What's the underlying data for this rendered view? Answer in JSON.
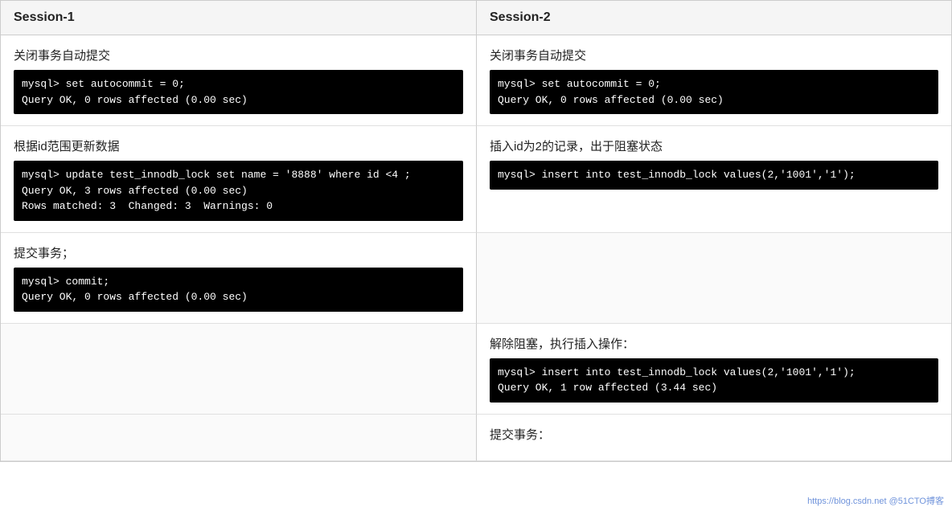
{
  "sessions": {
    "session1_header": "Session-1",
    "session2_header": "Session-2"
  },
  "rows": [
    {
      "left": {
        "label": "关闭事务自动提交",
        "code": "mysql> set autocommit = 0;\nQuery OK, 0 rows affected (0.00 sec)"
      },
      "right": {
        "label": "关闭事务自动提交",
        "code": "mysql> set autocommit = 0;\nQuery OK, 0 rows affected (0.00 sec)"
      }
    },
    {
      "left": {
        "label": "根据id范围更新数据",
        "code": "mysql> update test_innodb_lock set name = '8888' where id <4 ;\nQuery OK, 3 rows affected (0.00 sec)\nRows matched: 3  Changed: 3  Warnings: 0"
      },
      "right": {
        "label": "插入id为2的记录，出于阻塞状态",
        "code": "mysql> insert into test_innodb_lock values(2,'1001','1');"
      }
    },
    {
      "left": {
        "label": "提交事务；",
        "code": "mysql> commit;\nQuery OK, 0 rows affected (0.00 sec)"
      },
      "right": {
        "label": "",
        "code": ""
      }
    },
    {
      "left": {
        "label": "",
        "code": ""
      },
      "right": {
        "label": "解除阻塞，执行插入操作：",
        "code": "mysql> insert into test_innodb_lock values(2,'1001','1');\nQuery OK, 1 row affected (3.44 sec)"
      }
    },
    {
      "left": {
        "label": "",
        "code": ""
      },
      "right": {
        "label": "提交事务：",
        "code": ""
      }
    }
  ],
  "watermark": "https://blog.csdn.net @51CTO搏客"
}
